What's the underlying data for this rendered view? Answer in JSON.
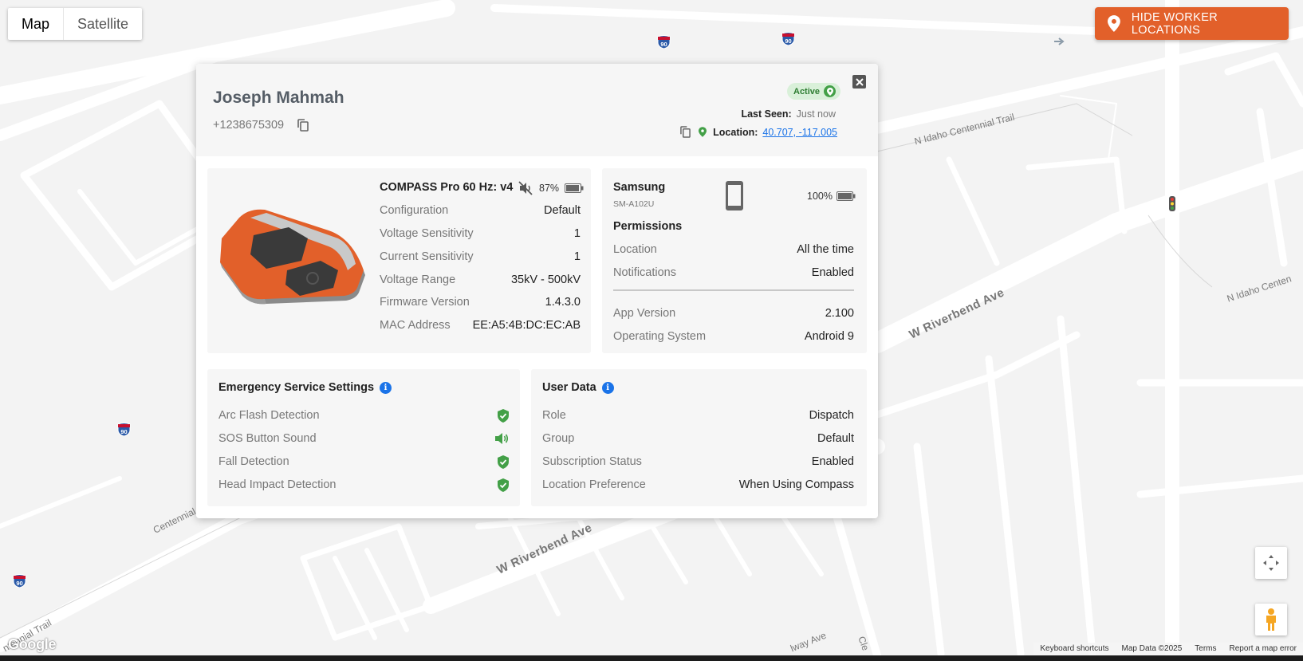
{
  "map": {
    "type_control": {
      "map_label": "Map",
      "satellite_label": "Satellite",
      "selected": "Map"
    },
    "hide_button": {
      "label": "HIDE WORKER LOCATIONS",
      "icon": "map-pin-icon",
      "color": "#e2602a"
    },
    "road_labels": [
      "N Idaho Centennial Trail",
      "W Riverbend Ave",
      "W Riverbend Ave",
      "N Idaho Centen",
      "Centennial",
      "ntennial Trail",
      "lway Ave",
      "Cle"
    ],
    "interstate_shield": "90",
    "google_logo": "Google",
    "attribution": [
      "Keyboard shortcuts",
      "Map Data ©2025",
      "Terms",
      "Report a map error"
    ]
  },
  "worker": {
    "name": "Joseph Mahmah",
    "phone": "+1238675309",
    "status": "Active",
    "last_seen_label": "Last Seen:",
    "last_seen_value": "Just now",
    "location_label": "Location:",
    "location_value": "40.707, -117.005"
  },
  "compass": {
    "title": "COMPASS Pro 60 Hz: v4",
    "battery_pct": "87%",
    "muted": true,
    "color": "#e2602a",
    "rows": [
      {
        "k": "Configuration",
        "v": "Default"
      },
      {
        "k": "Voltage Sensitivity",
        "v": "1"
      },
      {
        "k": "Current Sensitivity",
        "v": "1"
      },
      {
        "k": "Voltage Range",
        "v": "35kV - 500kV"
      },
      {
        "k": "Firmware Version",
        "v": "1.4.3.0"
      },
      {
        "k": "MAC Address",
        "v": "EE:A5:4B:DC:EC:AB"
      }
    ]
  },
  "phone": {
    "brand": "Samsung",
    "model": "SM-A102U",
    "battery_pct": "100%",
    "permissions_title": "Permissions",
    "permissions": [
      {
        "k": "Location",
        "v": "All the time"
      },
      {
        "k": "Notifications",
        "v": "Enabled"
      }
    ],
    "info": [
      {
        "k": "App Version",
        "v": "2.100"
      },
      {
        "k": "Operating System",
        "v": "Android 9"
      }
    ]
  },
  "emergency": {
    "title": "Emergency Service Settings",
    "items": [
      {
        "k": "Arc Flash Detection",
        "icon": "shield-check-icon"
      },
      {
        "k": "SOS Button Sound",
        "icon": "speaker-icon"
      },
      {
        "k": "Fall Detection",
        "icon": "shield-check-icon"
      },
      {
        "k": "Head Impact Detection",
        "icon": "shield-check-icon"
      }
    ],
    "icon_color": "#43a047"
  },
  "user_data": {
    "title": "User Data",
    "rows": [
      {
        "k": "Role",
        "v": "Dispatch"
      },
      {
        "k": "Group",
        "v": "Default"
      },
      {
        "k": "Subscription Status",
        "v": "Enabled"
      },
      {
        "k": "Location Preference",
        "v": "When Using Compass"
      }
    ]
  }
}
